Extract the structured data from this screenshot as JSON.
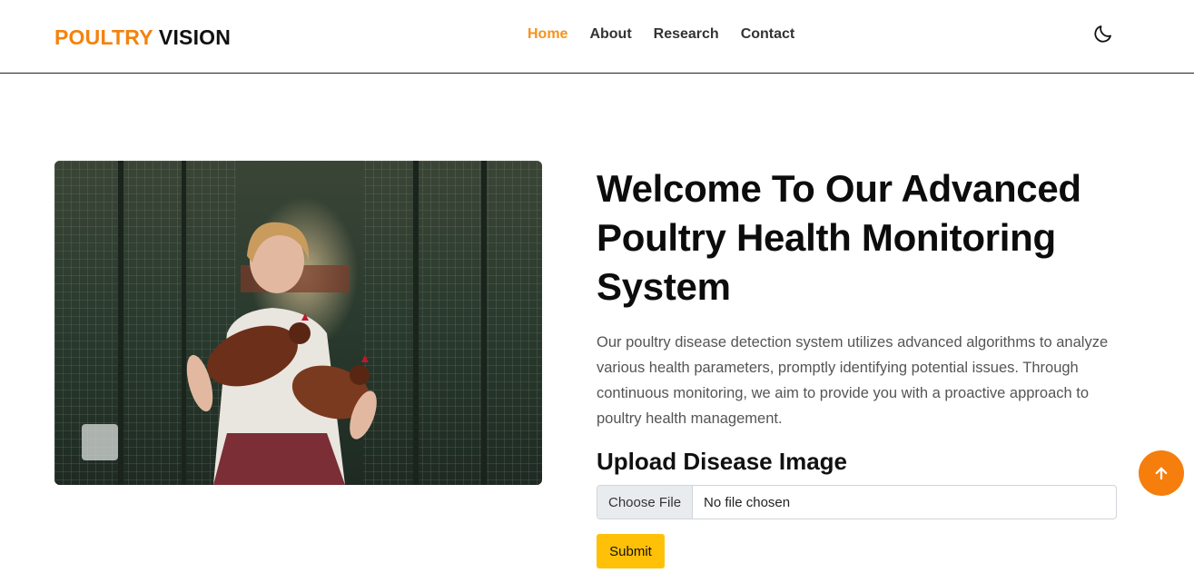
{
  "brand": {
    "part1": "POULTRY",
    "part2": "VISION"
  },
  "nav": {
    "items": [
      {
        "label": "Home",
        "active": true
      },
      {
        "label": "About"
      },
      {
        "label": "Research"
      },
      {
        "label": "Contact"
      }
    ],
    "theme_icon": "moon-icon"
  },
  "hero": {
    "image_icon": "farmer-with-chickens-photo",
    "title": "Welcome To Our Advanced Poultry Health Monitoring System",
    "description": "Our poultry disease detection system utilizes advanced algorithms to analyze various health parameters, promptly identifying potential issues. Through continuous monitoring, we aim to provide you with a proactive approach to poultry health management."
  },
  "upload": {
    "title": "Upload Disease Image",
    "choose_file_label": "Choose File",
    "file_status": "No file chosen",
    "submit_label": "Submit"
  },
  "scroll_top": {
    "icon": "arrow-up-icon"
  },
  "colors": {
    "brand_orange": "#f5820d",
    "active_nav": "#f5921d",
    "submit_yellow": "#ffc107",
    "scroll_top_bg": "#f57e0d"
  }
}
